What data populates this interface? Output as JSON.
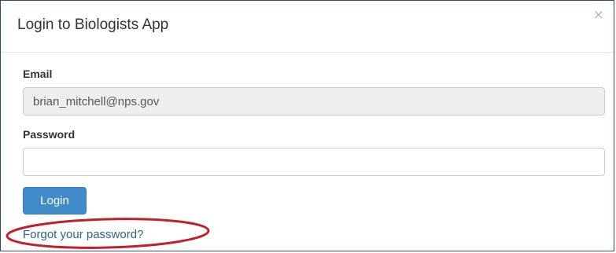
{
  "modal": {
    "title": "Login to Biologists App",
    "close_glyph": "×"
  },
  "form": {
    "email_label": "Email",
    "email_value": "brian_mitchell@nps.gov",
    "password_label": "Password",
    "password_value": "",
    "login_label": "Login",
    "forgot_label": "Forgot your password?"
  },
  "colors": {
    "primary_button": "#428bca",
    "link": "#2a6496",
    "annotation": "#c0202a"
  }
}
